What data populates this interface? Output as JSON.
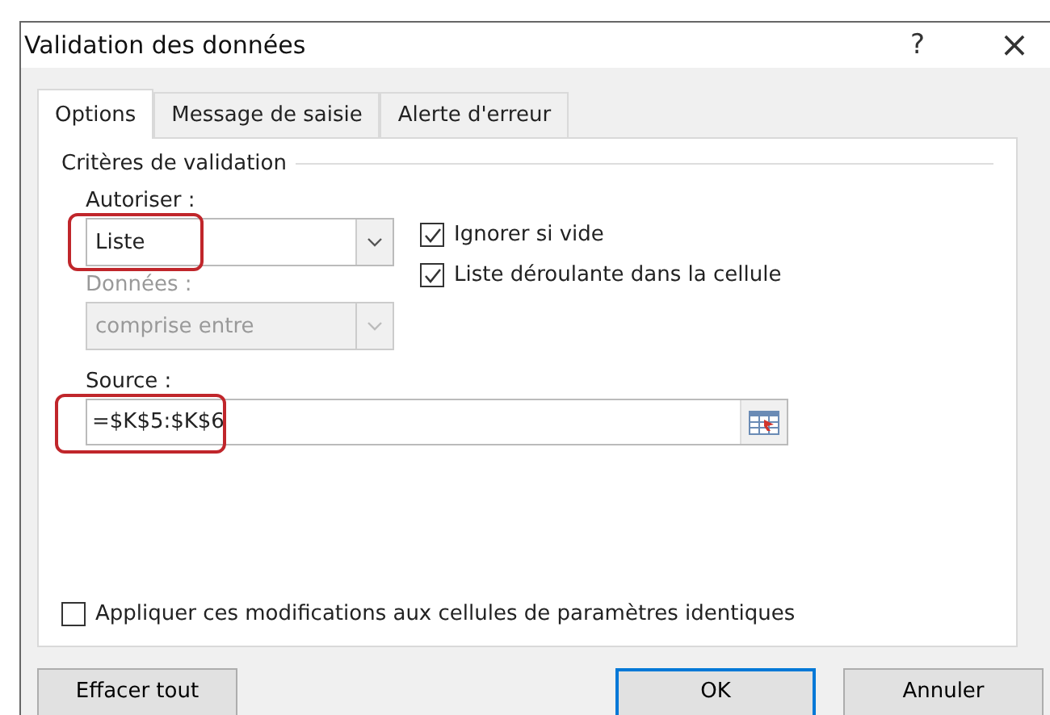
{
  "window": {
    "title": "Validation des données",
    "help": "?",
    "close": "×"
  },
  "tabs": [
    {
      "label": "Options",
      "selected": true
    },
    {
      "label": "Message de saisie",
      "selected": false
    },
    {
      "label": "Alerte d'erreur",
      "selected": false
    }
  ],
  "group": {
    "title": "Critères de validation"
  },
  "allow": {
    "label": "Autoriser :",
    "value": "Liste",
    "highlighted": true,
    "disabled": false
  },
  "data": {
    "label": "Données :",
    "value": "comprise entre",
    "disabled": true
  },
  "checkboxes": [
    {
      "label": "Ignorer si vide",
      "checked": true
    },
    {
      "label": "Liste déroulante dans la cellule",
      "checked": true
    }
  ],
  "source": {
    "label": "Source :",
    "value": "=$K$5:$K$6",
    "highlighted": true
  },
  "apply_all": {
    "label": "Appliquer ces modifications aux cellules de paramètres identiques",
    "checked": false
  },
  "buttons": [
    {
      "label": "Effacer tout",
      "kind": "left",
      "default": false
    },
    {
      "label": "OK",
      "kind": "right",
      "default": true
    },
    {
      "label": "Annuler",
      "kind": "right",
      "default": false
    }
  ]
}
